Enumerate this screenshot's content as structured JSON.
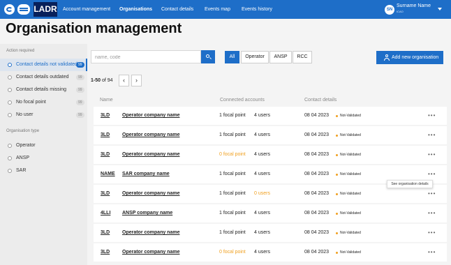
{
  "header": {
    "brand": "LADR",
    "nav": [
      "Account management",
      "Organisations",
      "Contact details",
      "Events map",
      "Events history"
    ],
    "active_nav": "Organisations",
    "user": {
      "initials": "SN",
      "name": "Surname Name",
      "org": "ICAO"
    }
  },
  "page_title": "Organisation management",
  "sidebar": {
    "action_heading": "Action required",
    "action_items": [
      {
        "label": "Contact details not validated",
        "count": "99",
        "active": true
      },
      {
        "label": "Contact details outdated",
        "count": "99"
      },
      {
        "label": "Contact details missing",
        "count": "99"
      },
      {
        "label": "No focal point",
        "count": "99"
      },
      {
        "label": "No user",
        "count": "99"
      }
    ],
    "type_heading": "Organisation type",
    "type_items": [
      "Operator",
      "ANSP",
      "SAR"
    ]
  },
  "search": {
    "placeholder": "name, code"
  },
  "filters": [
    "All",
    "Operator",
    "ANSP",
    "RCC"
  ],
  "active_filter": "All",
  "add_button": "Add new organisation",
  "pagination": {
    "range": "1-50",
    "of_label": "of 94",
    "prev": "‹",
    "next": "›"
  },
  "table": {
    "columns": {
      "name": "Name",
      "accounts": "Connected accounts",
      "contact": "Contact details"
    },
    "rows": [
      {
        "code": "3LD",
        "name": "Operator company name",
        "focal": "1 focal point",
        "users": "4 users",
        "date": "08 04 2023",
        "status": "Not-Validated"
      },
      {
        "code": "3LD",
        "name": "Operator company name",
        "focal": "1 focal point",
        "users": "4 users",
        "date": "08 04 2023",
        "status": "Not-Validated"
      },
      {
        "code": "3LD",
        "name": "Operator company name",
        "focal": "0 focal point",
        "users": "4 users",
        "date": "08 04 2023",
        "status": "Not-Validated",
        "focal_warn": true
      },
      {
        "code": "NAME",
        "name": "SAR company name",
        "focal": "1 focal point",
        "users": "4 users",
        "date": "08 04 2023",
        "status": "Not-Validated"
      },
      {
        "code": "3LD",
        "name": "Operator company name",
        "focal": "1 focal point",
        "users": "0 users",
        "date": "08 04 2023",
        "status": "Not-Validated",
        "users_warn": true
      },
      {
        "code": "4LLI",
        "name": "ANSP company name",
        "focal": "1 focal point",
        "users": "4 users",
        "date": "08 04 2023",
        "status": "Not-Validated"
      },
      {
        "code": "3LD",
        "name": "Operator company name",
        "focal": "1 focal point",
        "users": "4 users",
        "date": "08 04 2023",
        "status": "Not-Validated"
      },
      {
        "code": "3LD",
        "name": "Operator company name",
        "focal": "0 focal point",
        "users": "4 users",
        "date": "08 04 2023",
        "status": "Not-Validated",
        "focal_warn": true
      }
    ],
    "more_label": "•••"
  },
  "tooltip": "See organisation details",
  "colors": {
    "primary": "#1e6ec8",
    "brand_dark": "#08205a",
    "warning": "#f0a020"
  }
}
